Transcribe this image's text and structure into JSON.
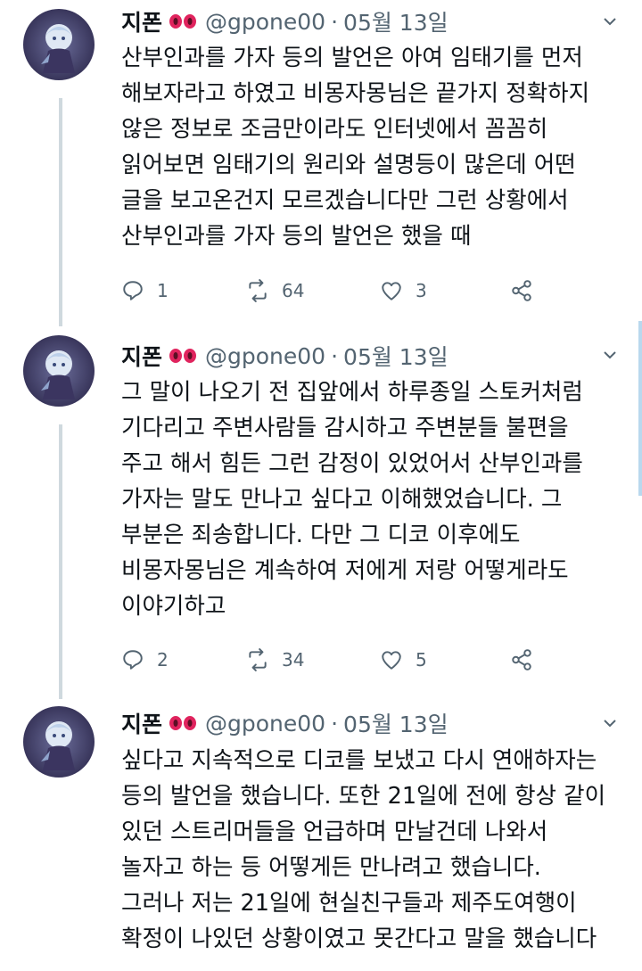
{
  "tweets": [
    {
      "name": "지폰",
      "handle": "@gpone00",
      "separator": "·",
      "date": "05월 13일",
      "text": "산부인과를 가자 등의 발언은 아여 임태기를 먼저\n해보자라고 하였고 비몽자몽님은 끝가지 정확하지\n않은 정보로 조금만이라도 인터넷에서 꼼꼼히\n읽어보면 임태기의 원리와 설명등이 많은데 어떤\n글을 보고온건지 모르겠습니다만 그런 상황에서\n산부인과를 가자 등의 발언은 했을 때",
      "replies": "1",
      "retweets": "64",
      "likes": "3"
    },
    {
      "name": "지폰",
      "handle": "@gpone00",
      "separator": "·",
      "date": "05월 13일",
      "text": "그 말이 나오기 전 집앞에서 하루종일 스토커처럼\n기다리고 주변사람들 감시하고 주변분들 불편을\n주고 해서 힘든 그런 감정이 있었어서 산부인과를\n가자는 말도 만나고 싶다고 이해했었습니다. 그\n부분은 죄송합니다. 다만 그 디코 이후에도\n비몽자몽님은 계속하여 저에게 저랑 어떻게라도\n이야기하고",
      "replies": "2",
      "retweets": "34",
      "likes": "5"
    },
    {
      "name": "지폰",
      "handle": "@gpone00",
      "separator": "·",
      "date": "05월 13일",
      "text": "싶다고 지속적으로 디코를 보냈고 다시 연애하자는\n등의 발언을 했습니다. 또한 21일에 전에 항상 같이\n있던 스트리머들을 언급하며 만날건데 나와서\n놀자고 하는 등 어떻게든 만나려고 했습니다.\n그러나 저는 21일에 현실친구들과 제주도여행이\n확정이 나있던 상황이였고 못간다고 말을 했습니다"
    }
  ],
  "icons": {
    "reply": "reply-icon",
    "retweet": "retweet-icon",
    "like": "heart-icon",
    "share": "share-icon",
    "more": "chevron-down-icon",
    "name_emoji": "pig-nose-emoji",
    "avatar": "avatar-image"
  },
  "colors": {
    "text": "#0f1419",
    "secondary": "#536471",
    "thread_line": "#cfd9de",
    "emoji_red": "#e0245e"
  }
}
